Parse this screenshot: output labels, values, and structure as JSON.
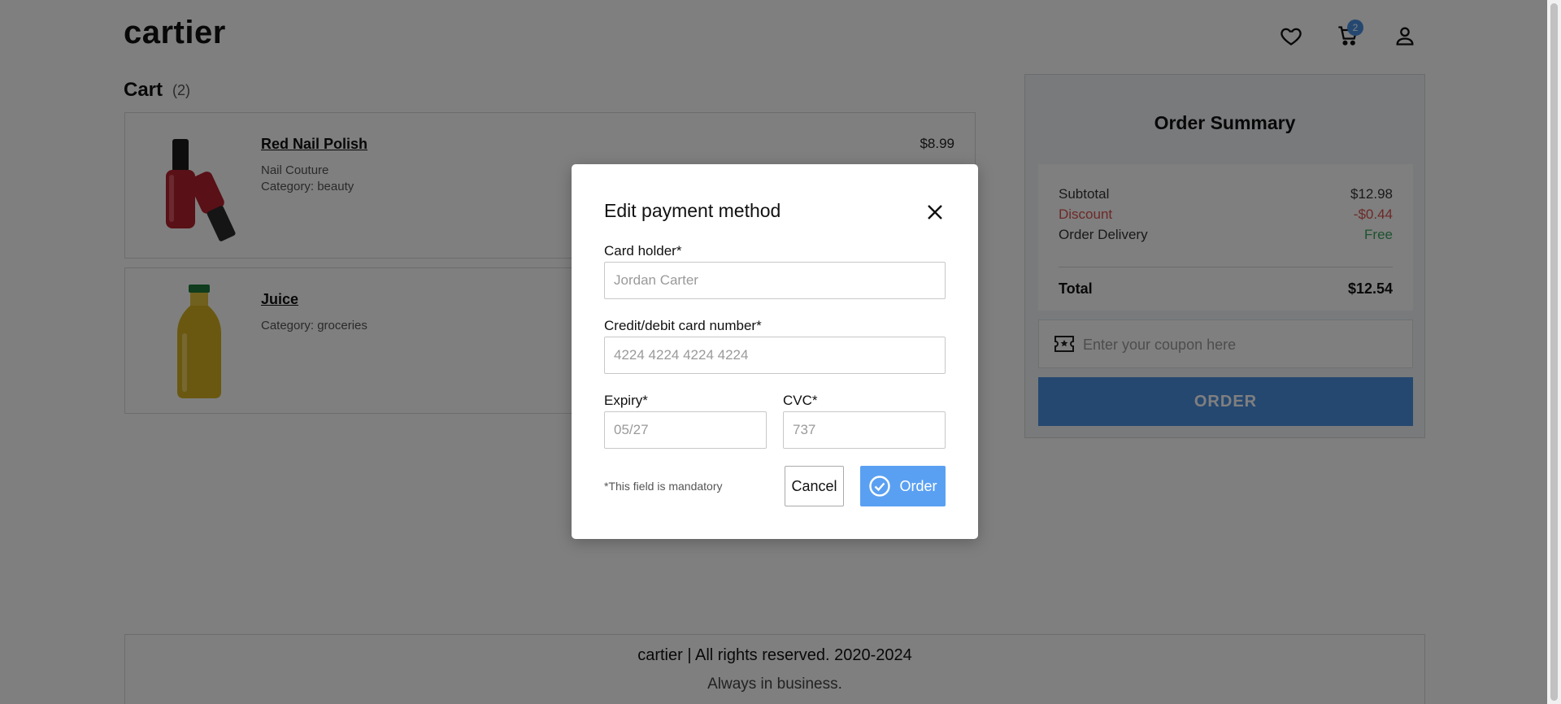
{
  "header": {
    "logo": "cartier",
    "cart_badge": "2",
    "icons": [
      "heart-icon",
      "cart-icon",
      "user-icon"
    ]
  },
  "cart": {
    "title": "Cart",
    "count": "(2)",
    "items": [
      {
        "name": "Red Nail Polish",
        "brand": "Nail Couture",
        "category": "Category: beauty",
        "price": "$8.99"
      },
      {
        "name": "Juice",
        "category": "Category: groceries"
      }
    ]
  },
  "summary": {
    "title": "Order Summary",
    "subtotal_label": "Subtotal",
    "subtotal_value": "$12.98",
    "discount_label": "Discount",
    "discount_value": "-$0.44",
    "delivery_label": "Order Delivery",
    "delivery_value": "Free",
    "total_label": "Total",
    "total_value": "$12.54",
    "coupon_placeholder": "Enter your coupon here",
    "order_label": "ORDER"
  },
  "modal": {
    "title": "Edit payment method",
    "card_holder_label": "Card holder*",
    "card_holder_placeholder": "Jordan Carter",
    "card_number_label": "Credit/debit card number*",
    "card_number_placeholder": "4224 4224 4224 4224",
    "expiry_label": "Expiry*",
    "expiry_placeholder": "05/27",
    "cvc_label": "CVC*",
    "cvc_placeholder": "737",
    "mandatory_note": "*This field is mandatory",
    "cancel_label": "Cancel",
    "order_label": "Order"
  },
  "footer": {
    "line1": "cartier | All rights reserved. 2020-2024",
    "line2": "Always in business."
  },
  "colors": {
    "accent": "#4a90e2",
    "discount": "#d9534f",
    "free": "#3aa55d"
  }
}
